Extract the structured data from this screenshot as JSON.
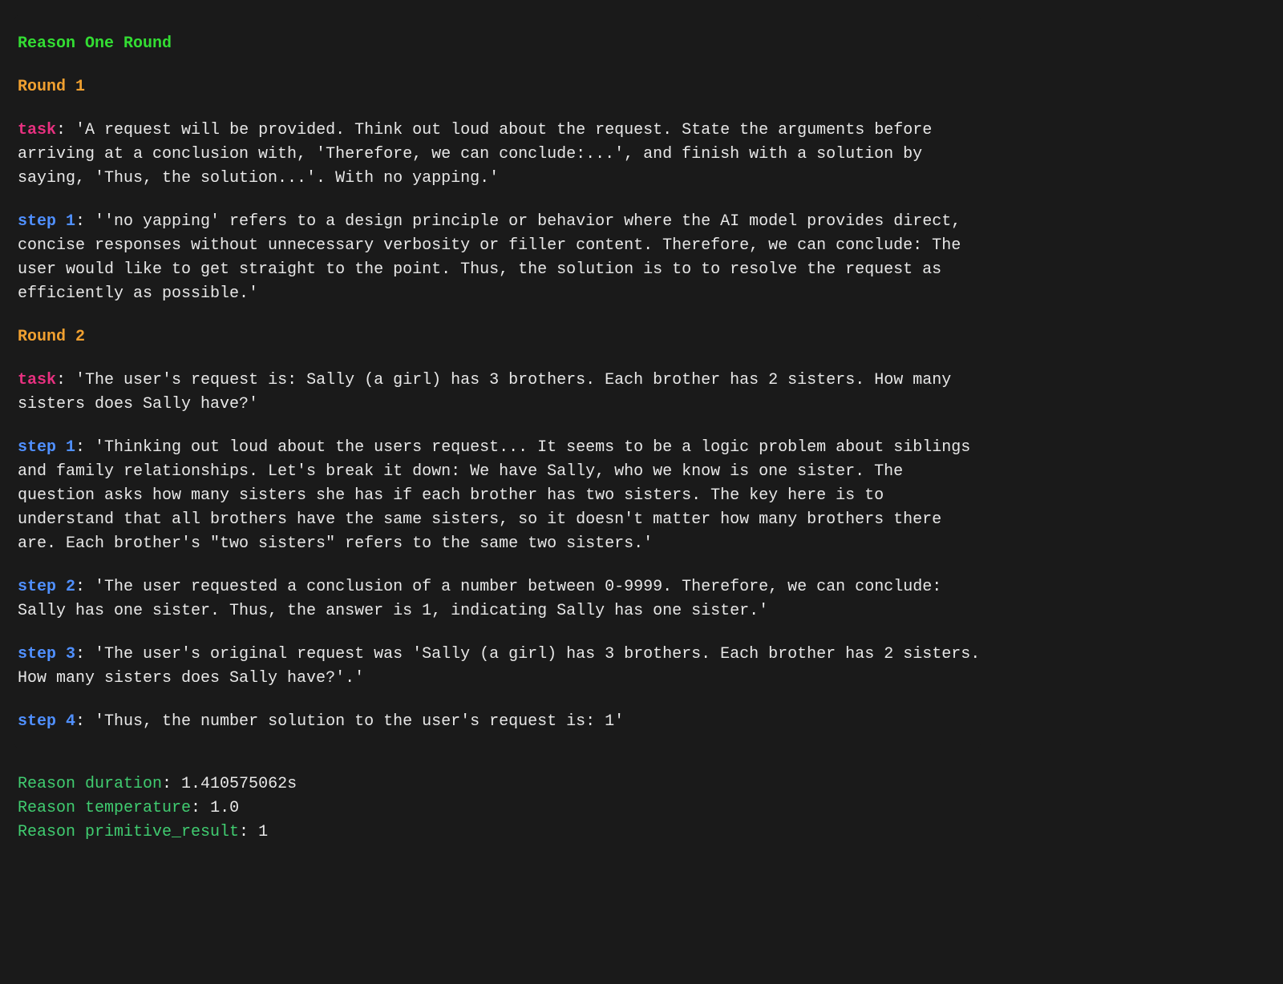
{
  "title": "Reason One Round",
  "rounds": [
    {
      "header": "Round 1",
      "task": {
        "label": "task",
        "text": "'A request will be provided. Think out loud about the request. State the arguments before arriving at a conclusion with, 'Therefore, we can conclude:...', and finish with a solution by saying, 'Thus, the solution...'. With no yapping.'"
      },
      "steps": [
        {
          "label": "step 1",
          "text": "''no yapping' refers to a design principle or behavior where the AI model provides direct, concise responses without unnecessary verbosity or filler content. Therefore, we can conclude: The user would like to get straight to the point. Thus, the solution is to to resolve the request as efficiently as possible.'"
        }
      ]
    },
    {
      "header": "Round 2",
      "task": {
        "label": "task",
        "text": "'The user's request is: Sally (a girl) has 3 brothers. Each brother has 2 sisters. How many sisters does Sally have?'"
      },
      "steps": [
        {
          "label": "step 1",
          "text": "'Thinking out loud about the users request... It seems to be a logic problem about siblings and family relationships. Let's break it down: We have Sally, who we know is one sister. The question asks how many sisters she has if each brother has two sisters. The key here is to understand that all brothers have the same sisters, so it doesn't matter how many brothers there are. Each brother's \"two sisters\" refers to the same two sisters.'"
        },
        {
          "label": "step 2",
          "text": "'The user requested a conclusion of a number between 0-9999. Therefore, we can conclude: Sally has one sister. Thus, the answer is 1, indicating Sally has one sister.'"
        },
        {
          "label": "step 3",
          "text": "'The user's original request was 'Sally (a girl) has 3 brothers. Each brother has 2 sisters. How many sisters does Sally have?'.'"
        },
        {
          "label": "step 4",
          "text": "'Thus, the number solution to the user's request is: 1'"
        }
      ]
    }
  ],
  "stats": {
    "duration": {
      "label": "Reason duration",
      "value": "1.410575062s"
    },
    "temperature": {
      "label": "Reason temperature",
      "value": "1.0"
    },
    "primitive_result": {
      "label": "Reason primitive_result",
      "value": "1"
    }
  }
}
